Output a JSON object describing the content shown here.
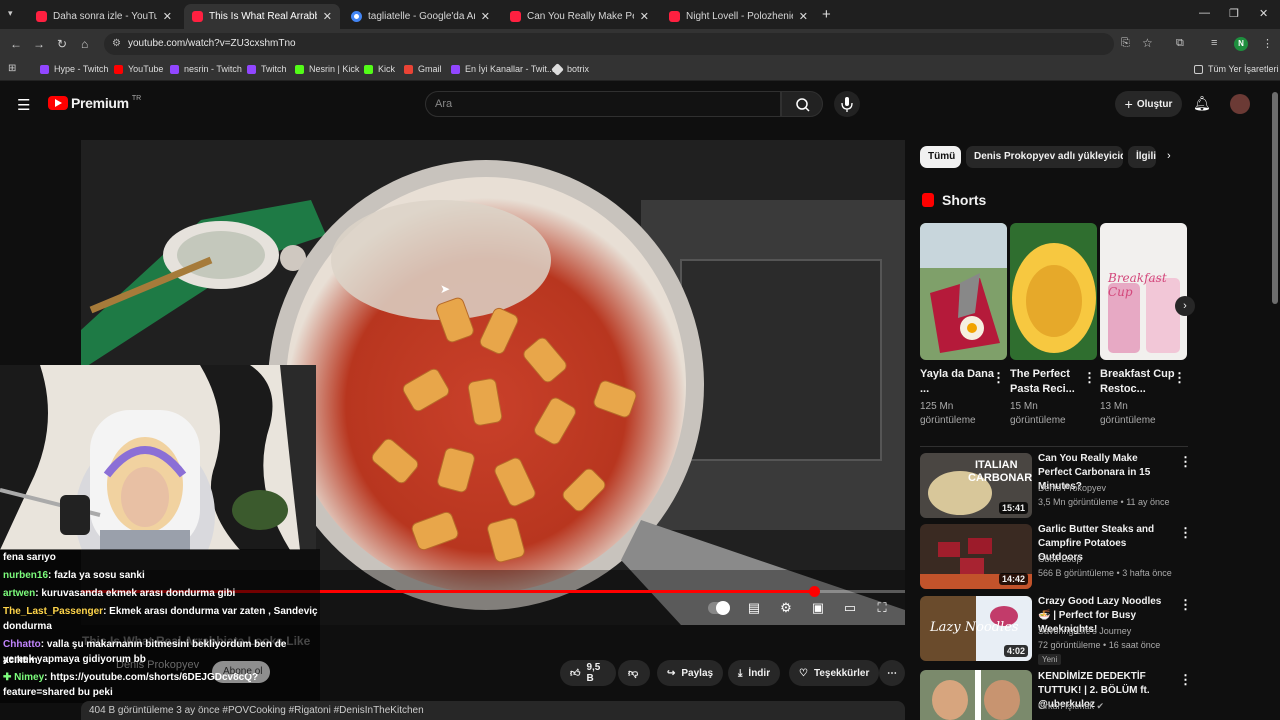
{
  "browser": {
    "tabs": [
      {
        "label": "Daha sonra izle - YouTube",
        "icon": "youtube-icon"
      },
      {
        "label": "This Is What Real Arrabbiata Lo",
        "icon": "youtube-icon"
      },
      {
        "label": "tagliatelle - Google'da Ara",
        "icon": "google-icon"
      },
      {
        "label": "Can You Really Make Perfect Ca",
        "icon": "youtube-icon"
      },
      {
        "label": "Night Lovell - Polozhenie - You",
        "icon": "youtube-icon"
      }
    ],
    "url": "youtube.com/watch?v=ZU3cxshmTno",
    "profile_initial": "N",
    "bookmarks": [
      "Hype - Twitch",
      "YouTube",
      "nesrin - Twitch",
      "Twitch",
      "Nesrin | Kick",
      "Kick",
      "Gmail",
      "En İyi Kanallar - Twit...",
      "botrix"
    ],
    "all_bookmarks": "Tüm Yer İşaretleri"
  },
  "youtube": {
    "logo": "Premium",
    "region": "TR",
    "search_placeholder": "Ara",
    "create_label": "Oluştur"
  },
  "video": {
    "progress": 0.89,
    "title_overlay": "This Is What Real Arrabbiata Looks Like",
    "channel": "Denis Prokopyev",
    "subscribe": "Abone ol",
    "likes": "9,5 B",
    "share": "Paylaş",
    "download": "İndir",
    "thanks": "Teşekkürler",
    "description": "404 B görüntüleme  3 ay önce  #POVCooking #Rigatoni #DenisInTheKitchen"
  },
  "chat": [
    {
      "user": "",
      "text": "fena sarıyo",
      "color": "#ffffff"
    },
    {
      "user": "nurben16",
      "text": ": fazla ya sosu sanki",
      "color": "#7cfc7c"
    },
    {
      "user": "artwen",
      "text": ": kuruvasanda ekmek arası dondurma gibi",
      "color": "#7cfc7c"
    },
    {
      "user": "The_Last_Passenger",
      "text": ": Ekmek arası dondurma var zaten , Sandeviç",
      "color": "#ffd54a"
    },
    {
      "user": "",
      "text": "dondurma",
      "color": "#ffffff"
    },
    {
      "user": "Chhatto",
      "text": ": valla şu makarnanın bitmesini bekliyordum ben de acıktım",
      "color": "#c084fc"
    },
    {
      "user": "",
      "text": "yemek yapmaya gidiyorum bb",
      "color": "#ffffff"
    },
    {
      "user": "✚ Nimey",
      "text": ": https://youtube.com/shorts/6DEJGDcv8cQ?",
      "color": "#7cfc7c"
    },
    {
      "user": "",
      "text": "feature=shared bu peki",
      "color": "#ffffff"
    }
  ],
  "sidebar": {
    "chips": [
      "Tümü",
      "Denis Prokopyev adlı yükleyiciden",
      "İlgili"
    ],
    "shorts_heading": "Shorts",
    "shorts": [
      {
        "title": "Yayla da Dana ...",
        "views": "125 Mn görüntüleme"
      },
      {
        "title": "The Perfect Pasta Reci...",
        "views": "15 Mn görüntüleme"
      },
      {
        "title": "Breakfast Cup Restoc...",
        "views": "13 Mn görüntüleme"
      }
    ],
    "recommendations": [
      {
        "title": "Can You Really Make Perfect Carbonara in 15 Minutes?",
        "channel": "Denis Prokopyev",
        "meta": "3,5 Mn görüntüleme • 11 ay önce",
        "duration": "15:41",
        "badge": ""
      },
      {
        "title": "Garlic Butter Steaks and Campfire Potatoes Outdoors",
        "channel": "Cook Loop",
        "meta": "566 B görüntüleme • 3 hafta önce",
        "duration": "14:42",
        "badge": ""
      },
      {
        "title": "Crazy Good Lazy Noodles 🍜 | Perfect for Busy Weeknights!",
        "channel": "Savoring Life's Journey",
        "meta": "72 görüntüleme • 16 saat önce",
        "duration": "4:02",
        "badge": "Yeni"
      },
      {
        "title": "KENDİMİZE DEDEKTİF TUTTUK! | 2. BÖLÜM  ft. @uberkuloz",
        "channel": "Orkun Işıtmak ✔",
        "meta": "",
        "duration": "",
        "badge": ""
      }
    ],
    "thumb_text": {
      "carbonara_1": "ITALIAN",
      "carbonara_2": "CARBONARA",
      "lazy": "Lazy Noodles",
      "breakfast": "Breakfast Cup"
    }
  }
}
